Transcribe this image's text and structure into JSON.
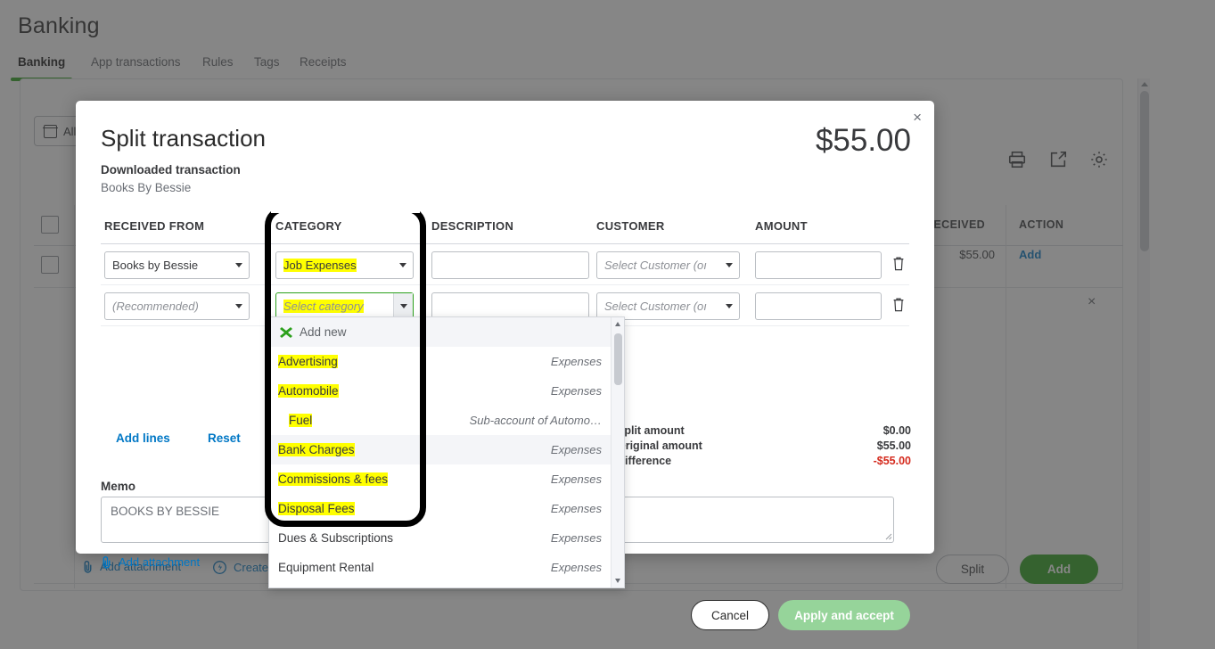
{
  "background": {
    "page_title": "Banking",
    "tabs": [
      {
        "label": "Banking",
        "active": true
      },
      {
        "label": "App transactions",
        "active": false
      },
      {
        "label": "Rules",
        "active": false
      },
      {
        "label": "Tags",
        "active": false
      },
      {
        "label": "Receipts",
        "active": false
      }
    ],
    "filter_chip": "All",
    "toolbar_icons": [
      "print-icon",
      "export-icon",
      "gear-icon"
    ],
    "table": {
      "headers": [
        "RECEIVED",
        "ACTION"
      ],
      "rows": [
        {
          "received": "$55.00",
          "action": "Add"
        }
      ]
    },
    "footer_links": [
      {
        "label": "Add attachment",
        "icon": "paperclip-icon"
      },
      {
        "label": "Create",
        "icon": "lightning-icon"
      }
    ],
    "buttons": {
      "split": "Split",
      "add": "Add"
    },
    "row_close": "×",
    "colors": {
      "brand_green": "#2ca01c",
      "link_blue": "#0077c5"
    }
  },
  "modal": {
    "close_label": "×",
    "title": "Split transaction",
    "subtitle_label": "Downloaded transaction",
    "subtitle_value": "Books By Bessie",
    "amount": "$55.00",
    "table": {
      "headers": [
        "RECEIVED FROM",
        "CATEGORY",
        "DESCRIPTION",
        "CUSTOMER",
        "AMOUNT"
      ],
      "rows": [
        {
          "received_from": "Books by Bessie",
          "received_from_ghost": false,
          "category": "Job Expenses",
          "category_highlight": true,
          "description": "",
          "customer": "Select Customer (oı",
          "customer_ghost": true,
          "amount": "",
          "delete_icon": "trash-icon"
        },
        {
          "received_from": "(Recommended)",
          "received_from_ghost": true,
          "category": "Select category",
          "category_highlight": true,
          "description": "",
          "customer": "Select Customer (oı",
          "customer_ghost": true,
          "amount": "",
          "delete_icon": "trash-icon"
        }
      ]
    },
    "links": {
      "add_lines": "Add lines",
      "reset": "Reset",
      "add_attachment": "Add attachment"
    },
    "memo": {
      "label": "Memo",
      "value": "BOOKS BY BESSIE"
    },
    "summary": [
      {
        "label": "Split amount",
        "value": "$0.00",
        "negative": false
      },
      {
        "label": "Original amount",
        "value": "$55.00",
        "negative": false
      },
      {
        "label": "Difference",
        "value": "-$55.00",
        "negative": true
      }
    ],
    "buttons": {
      "cancel": "Cancel",
      "apply": "Apply and accept"
    }
  },
  "dropdown": {
    "add_new": {
      "label": "Add new",
      "icon": "add-new-icon"
    },
    "items": [
      {
        "name": "Advertising",
        "type": "Expenses",
        "highlight": true,
        "sub": false,
        "alt": false
      },
      {
        "name": "Automobile",
        "type": "Expenses",
        "highlight": true,
        "sub": false,
        "alt": false
      },
      {
        "name": "Fuel",
        "type": "Sub-account of Automo…",
        "highlight": true,
        "sub": true,
        "alt": false
      },
      {
        "name": "Bank Charges",
        "type": "Expenses",
        "highlight": true,
        "sub": false,
        "alt": true
      },
      {
        "name": "Commissions & fees",
        "type": "Expenses",
        "highlight": true,
        "sub": false,
        "alt": false
      },
      {
        "name": "Disposal Fees",
        "type": "Expenses",
        "highlight": true,
        "sub": false,
        "alt": false
      },
      {
        "name": "Dues & Subscriptions",
        "type": "Expenses",
        "highlight": false,
        "sub": false,
        "alt": false
      },
      {
        "name": "Equipment Rental",
        "type": "Expenses",
        "highlight": false,
        "sub": false,
        "alt": false
      }
    ]
  },
  "annotation": {
    "shape": "rounded-rectangle",
    "color": "#000000",
    "note": "callout box around CATEGORY column and category dropdown list"
  }
}
